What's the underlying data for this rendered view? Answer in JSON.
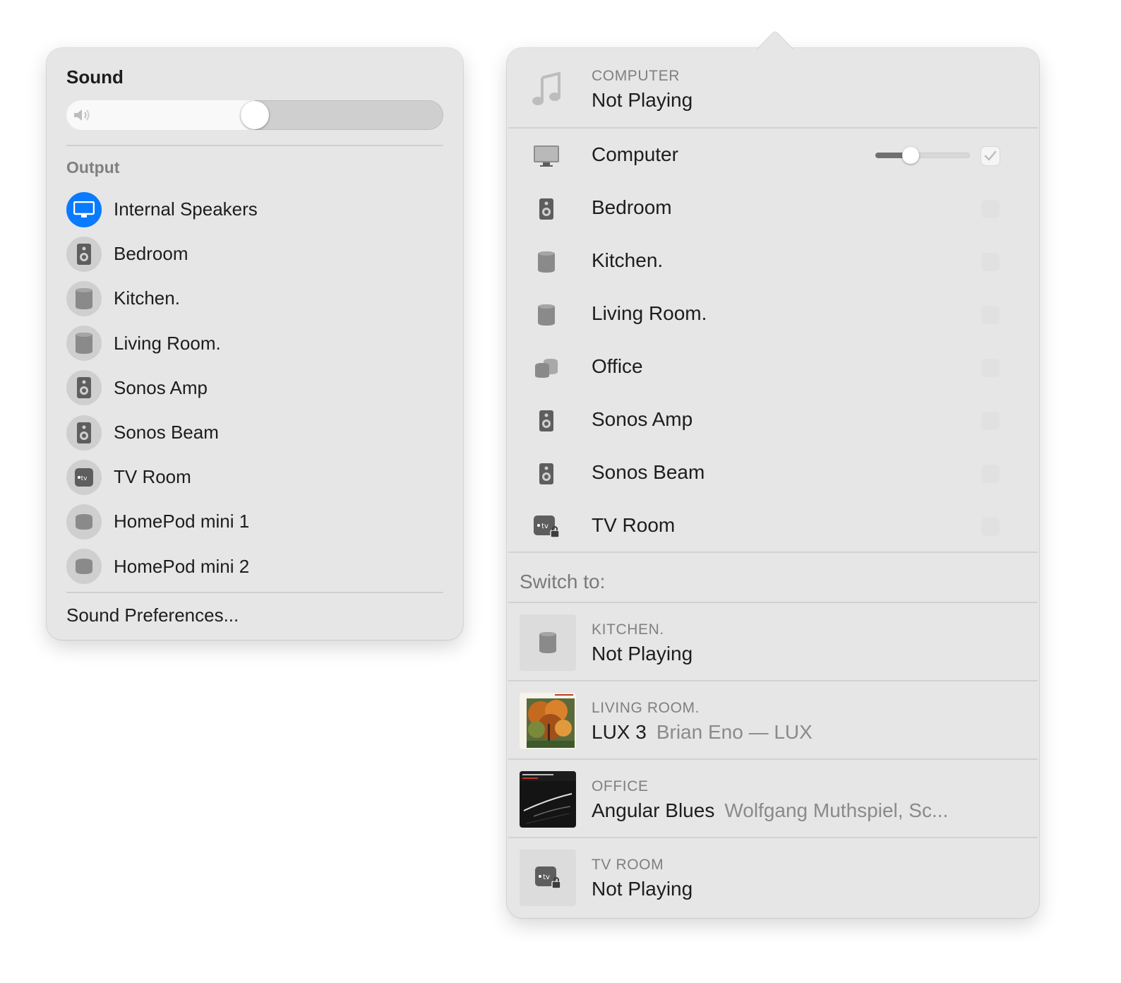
{
  "sound_menu": {
    "title": "Sound",
    "volume_percent": 50,
    "volume_icon": "speaker-volume-icon",
    "output_heading": "Output",
    "outputs": [
      {
        "label": "Internal Speakers",
        "icon": "display-icon",
        "selected": true
      },
      {
        "label": "Bedroom",
        "icon": "speaker-icon",
        "selected": false
      },
      {
        "label": "Kitchen.",
        "icon": "homepod-icon",
        "selected": false
      },
      {
        "label": "Living Room.",
        "icon": "homepod-icon",
        "selected": false
      },
      {
        "label": "Sonos Amp",
        "icon": "speaker-icon",
        "selected": false
      },
      {
        "label": "Sonos Beam",
        "icon": "speaker-icon",
        "selected": false
      },
      {
        "label": "TV Room",
        "icon": "apple-tv-icon",
        "selected": false
      },
      {
        "label": "HomePod mini 1",
        "icon": "homepod-mini-icon",
        "selected": false
      },
      {
        "label": "HomePod mini 2",
        "icon": "homepod-mini-icon",
        "selected": false
      }
    ],
    "preferences_label": "Sound Preferences..."
  },
  "airplay_menu": {
    "now_playing": {
      "caption": "COMPUTER",
      "title": "Not Playing",
      "icon": "music-note-icon"
    },
    "computer_volume_percent": 37,
    "devices": [
      {
        "label": "Computer",
        "icon": "display-icon",
        "checked": true
      },
      {
        "label": "Bedroom",
        "icon": "speaker-icon",
        "checked": false
      },
      {
        "label": "Kitchen.",
        "icon": "homepod-icon",
        "checked": false
      },
      {
        "label": "Living Room.",
        "icon": "homepod-icon",
        "checked": false
      },
      {
        "label": "Office",
        "icon": "homepod-pair-icon",
        "checked": false
      },
      {
        "label": "Sonos Amp",
        "icon": "speaker-icon",
        "checked": false
      },
      {
        "label": "Sonos Beam",
        "icon": "speaker-icon",
        "checked": false
      },
      {
        "label": "TV Room",
        "icon": "apple-tv-lock-icon",
        "checked": false
      }
    ],
    "switch_heading": "Switch to:",
    "switch_targets": [
      {
        "caption": "KITCHEN.",
        "title": "Not Playing",
        "subtitle": "",
        "art": "homepod-icon"
      },
      {
        "caption": "LIVING ROOM.",
        "title": "LUX 3",
        "subtitle": "Brian Eno — LUX",
        "art": "album-art-lux"
      },
      {
        "caption": "OFFICE",
        "title": "Angular Blues",
        "subtitle": "Wolfgang Muthspiel, Sc...",
        "art": "album-art-angular-blues"
      },
      {
        "caption": "TV ROOM",
        "title": "Not Playing",
        "subtitle": "",
        "art": "apple-tv-lock-icon"
      }
    ]
  }
}
